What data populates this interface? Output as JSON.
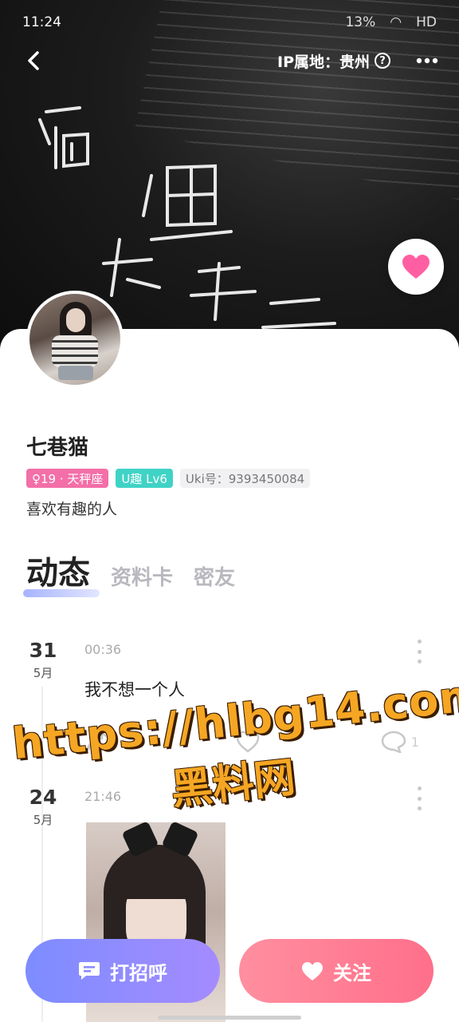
{
  "status_bar": {
    "time": "11:24",
    "network": "HD",
    "battery": "13%"
  },
  "header": {
    "ip_label": "IP属地：贵州",
    "help_symbol": "?"
  },
  "profile": {
    "nickname": "七巷猫",
    "age_constellation": "♀19 · 天秤座",
    "level": "U趣 Lv6",
    "uki_id": "Uki号：9393450084",
    "bio": "喜欢有趣的人"
  },
  "tabs": [
    {
      "label": "动态",
      "active": true
    },
    {
      "label": "资料卡",
      "active": false
    },
    {
      "label": "密友",
      "active": false
    }
  ],
  "posts": [
    {
      "day": "31",
      "month": "5月",
      "time": "00:36",
      "text": "我不想一个人",
      "comment_count": "1"
    },
    {
      "day": "24",
      "month": "5月",
      "time": "21:46",
      "text": ""
    }
  ],
  "watermark": {
    "line1": "https://hlbg14.com",
    "line2": "黑料网"
  },
  "buttons": {
    "greet": "打招呼",
    "follow": "关注"
  },
  "colors": {
    "accent_pink": "#ff6f8a",
    "accent_purple": "#7d8cff",
    "tag_pink": "#f36fa8",
    "tag_teal": "#3fd3c6",
    "watermark": "#f5a623"
  }
}
